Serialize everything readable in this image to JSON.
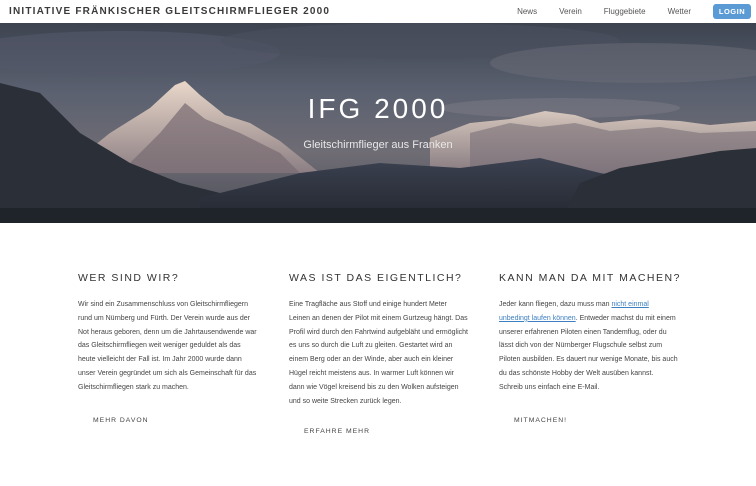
{
  "navbar": {
    "brand": "INITIATIVE FRÄNKISCHER GLEITSCHIRMFLIEGER 2000",
    "links": [
      "News",
      "Verein",
      "Fluggebiete",
      "Wetter"
    ],
    "login_label": "LOGIN",
    "login_color": "#5b9bd5"
  },
  "hero": {
    "title": "IFG 2000",
    "subtitle": "Gleitschirmflieger aus Franken"
  },
  "columns": [
    {
      "heading": "WER SIND WIR?",
      "text": "Wir sind ein Zusammenschluss von Gleitschirmfliegern rund um Nürnberg und Fürth. Der Verein wurde aus der Not heraus geboren, denn um die Jahrtausendwende war das Gleitschirmfliegen weit weniger geduldet als das heute vielleicht der Fall ist. Im Jahr 2000 wurde dann unser Verein gegründet um sich als Gemeinschaft für das Gleitschirmfliegen stark zu machen.",
      "button": "MEHR DAVON"
    },
    {
      "heading": "WAS IST DAS EIGENTLICH?",
      "text": "Eine Tragfläche aus Stoff und einige hundert Meter Leinen an denen der Pilot mit einem Gurtzeug hängt. Das Profil wird durch den Fahrtwind aufgebläht und ermöglicht es uns so durch die Luft zu gleiten. Gestartet wird an einem Berg oder an der Winde, aber auch ein kleiner Hügel reicht meistens aus. In warmer Luft können wir dann wie Vögel kreisend bis zu den Wolken aufsteigen und so weite Strecken zurück legen.",
      "button": "ERFAHRE MEHR"
    },
    {
      "heading": "KANN MAN DA MIT MACHEN?",
      "text_before": "Jeder kann fliegen, dazu muss man ",
      "link": "nicht einmal unbedingt laufen können",
      "text_after": ". Entweder machst du mit einem unserer erfahrenen Piloten einen Tandemflug, oder du lässt dich von der Nürnberger Flugschule selbst zum Piloten ausbilden. Es dauert nur wenige Monate, bis auch du das schönste Hobby der Welt ausüben kannst. Schreib uns einfach eine E-Mail.",
      "button": "MITMACHEN!"
    }
  ]
}
